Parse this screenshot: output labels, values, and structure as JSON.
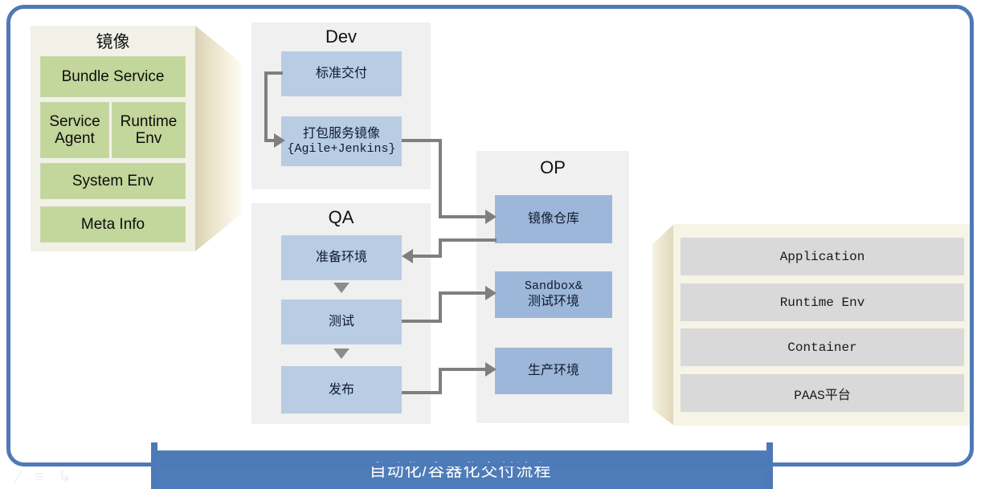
{
  "frame": {
    "accent_color": "#4e79b8"
  },
  "image_panel": {
    "title": "镜像",
    "color": "#c3d69b",
    "items": [
      {
        "label": "Bundle Service"
      },
      {
        "label": "Service\nAgent"
      },
      {
        "label": "Runtime\nEnv"
      },
      {
        "label": "System Env"
      },
      {
        "label": "Meta Info"
      }
    ]
  },
  "dev_panel": {
    "title": "Dev",
    "color": "#b8cce4",
    "items": [
      {
        "label": "标准交付",
        "sub": ""
      },
      {
        "label": "打包服务镜像",
        "sub": "{Agile+Jenkins}"
      }
    ]
  },
  "qa_panel": {
    "title": "QA",
    "color": "#b8cce4",
    "items": [
      {
        "label": "准备环境"
      },
      {
        "label": "测试"
      },
      {
        "label": "发布"
      }
    ]
  },
  "op_panel": {
    "title": "OP",
    "color": "#9cb7d9",
    "items": [
      {
        "label": "镜像仓库",
        "sub": ""
      },
      {
        "label": "Sandbox&",
        "sub": "测试环境"
      },
      {
        "label": "生产环境",
        "sub": ""
      }
    ]
  },
  "stack_panel": {
    "color": "#d9d9d9",
    "items": [
      {
        "label": "Application"
      },
      {
        "label": "Runtime Env"
      },
      {
        "label": "Container"
      },
      {
        "label": "PAAS平台"
      }
    ]
  },
  "banner": {
    "text": "自动化/容器化交付流程",
    "color": "#4e7cb9"
  },
  "watermark": {
    "text": "⁄ ≡ ↳"
  }
}
